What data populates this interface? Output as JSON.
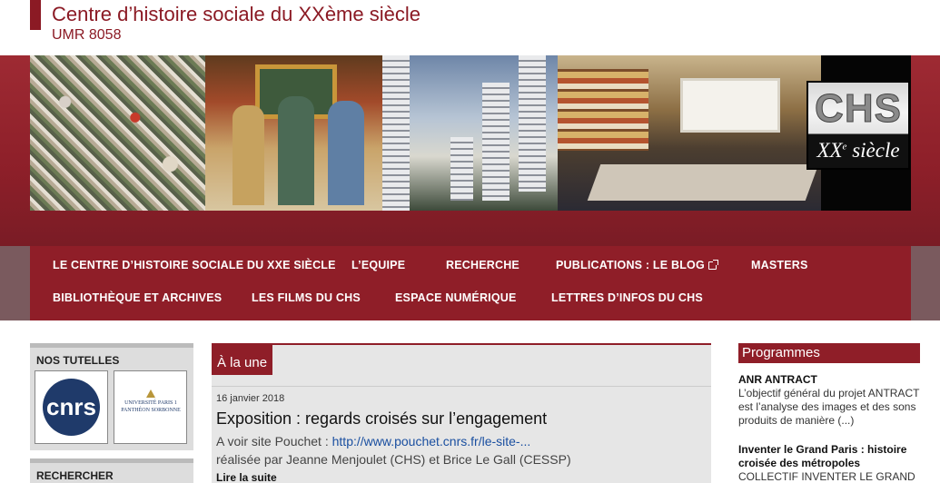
{
  "header": {
    "title": "Centre d’histoire sociale du XXème siècle",
    "subtitle": "UMR 8058"
  },
  "banner": {
    "logo_main": "CHS",
    "logo_sub": "XX",
    "logo_sup": "e",
    "logo_tail": " siècle"
  },
  "nav": {
    "row1": [
      {
        "label": "LE CENTRE D’HISTOIRE SOCIALE DU XXE SIÈCLE"
      },
      {
        "label": "L’EQUIPE"
      },
      {
        "label": "RECHERCHE"
      },
      {
        "label": "PUBLICATIONS : LE BLOG"
      },
      {
        "label": "MASTERS"
      }
    ],
    "row2": [
      {
        "label": "BIBLIOTHÈQUE ET ARCHIVES"
      },
      {
        "label": "LES FILMS DU CHS"
      },
      {
        "label": "ESPACE NUMÉRIQUE"
      },
      {
        "label": "LETTRES D’INFOS DU CHS"
      }
    ]
  },
  "sidebar": {
    "tutelles_heading": "NOS TUTELLES",
    "cnrs_logo_text": "cnrs",
    "pantheon_line1": "UNIVERSITÉ PARIS 1",
    "pantheon_line2": "PANTHÉON SORBONNE",
    "search_heading": "RECHERCHER"
  },
  "main": {
    "section_tab": "À la une",
    "post": {
      "date": "16 janvier 2018",
      "title": "Exposition : regards croisés sur l’engagement",
      "line1_prefix": "A voir site Pouchet : ",
      "line1_link": "http://www.pouchet.cnrs.fr/le-site-...",
      "line2": "réalisée par Jeanne Menjoulet (CHS) et Brice Le Gall (CESSP)",
      "read_more": "Lire la suite"
    }
  },
  "programmes": {
    "heading": "Programmes",
    "items": [
      {
        "title": "ANR ANTRACT",
        "text": "L’objectif général du projet ANTRACT est l’analyse des images et des sons produits de manière (...)"
      },
      {
        "title": "Inventer le Grand Paris : histoire croisée des métropoles",
        "text": "COLLECTIF INVENTER LE GRAND"
      }
    ]
  },
  "colors": {
    "brand": "#8f1e28",
    "link": "#1a4fa0"
  }
}
